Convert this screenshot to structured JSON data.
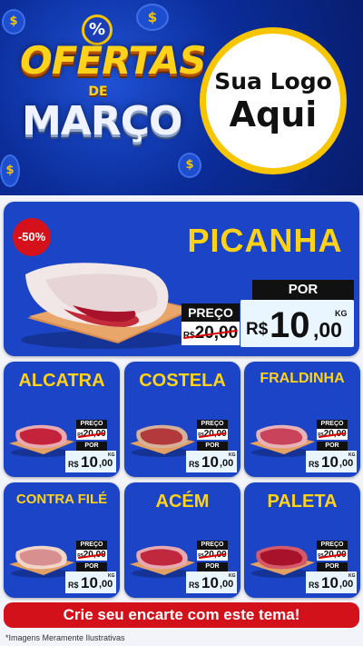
{
  "header": {
    "badge_symbol": "%",
    "title_top": "OFERTAS",
    "title_mid": "DE",
    "title_bottom": "MARÇO",
    "logo_line1": "Sua Logo",
    "logo_line2": "Aqui",
    "coin_symbol": "$"
  },
  "featured": {
    "name": "PICANHA",
    "discount": "-50%",
    "preco_label": "PREÇO",
    "old_currency": "R$",
    "old_value": "20,00",
    "por_label": "POR",
    "currency": "R$",
    "price_int": "10",
    "price_dec": ",00",
    "unit": "KG"
  },
  "products": [
    {
      "name": "ALCATRA",
      "preco_label": "PREÇO",
      "old_currency": "R$",
      "old_value": "20,00",
      "por_label": "POR",
      "currency": "R$",
      "price_int": "10",
      "price_dec": ",00",
      "unit": "KG"
    },
    {
      "name": "COSTELA",
      "preco_label": "PREÇO",
      "old_currency": "R$",
      "old_value": "20,00",
      "por_label": "POR",
      "currency": "R$",
      "price_int": "10",
      "price_dec": ",00",
      "unit": "KG"
    },
    {
      "name": "FRALDINHA",
      "preco_label": "PREÇO",
      "old_currency": "R$",
      "old_value": "20,00",
      "por_label": "POR",
      "currency": "R$",
      "price_int": "10",
      "price_dec": ",00",
      "unit": "KG"
    },
    {
      "name": "CONTRA FILÉ",
      "preco_label": "PREÇO",
      "old_currency": "R$",
      "old_value": "20,00",
      "por_label": "POR",
      "currency": "R$",
      "price_int": "10",
      "price_dec": ",00",
      "unit": "KG"
    },
    {
      "name": "ACÉM",
      "preco_label": "PREÇO",
      "old_currency": "R$",
      "old_value": "20,00",
      "por_label": "POR",
      "currency": "R$",
      "price_int": "10",
      "price_dec": ",00",
      "unit": "KG"
    },
    {
      "name": "PALETA",
      "preco_label": "PREÇO",
      "old_currency": "R$",
      "old_value": "20,00",
      "por_label": "POR",
      "currency": "R$",
      "price_int": "10",
      "price_dec": ",00",
      "unit": "KG"
    }
  ],
  "footer": {
    "cta": "Crie seu encarte com este tema!",
    "disclaimer": "*Imagens Meramente Ilustrativas"
  },
  "colors": {
    "brand_blue": "#1b45c6",
    "accent_yellow": "#ffd21a",
    "accent_red": "#d2111a"
  }
}
